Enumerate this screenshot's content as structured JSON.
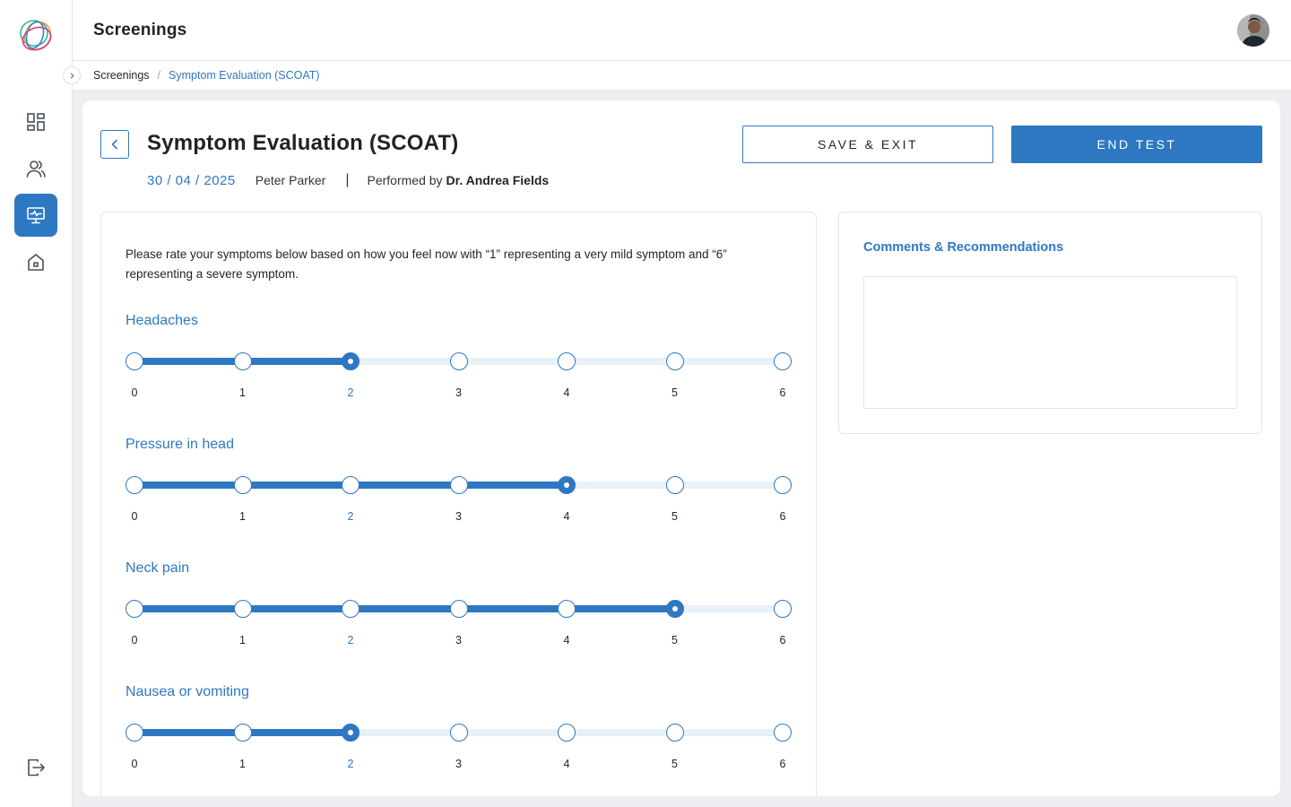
{
  "header": {
    "title": "Screenings"
  },
  "breadcrumb": {
    "items": [
      "Screenings"
    ],
    "separator": "/",
    "current": "Symptom Evaluation (SCOAT)"
  },
  "sidebar": {
    "items": [
      {
        "name": "dashboard",
        "icon": "dashboard-grid-icon",
        "active": false
      },
      {
        "name": "users",
        "icon": "users-icon",
        "active": false
      },
      {
        "name": "screenings",
        "icon": "monitor-screening-icon",
        "active": true
      },
      {
        "name": "home",
        "icon": "home-icon",
        "active": false
      }
    ],
    "logout_icon": "logout-icon"
  },
  "test": {
    "title": "Symptom Evaluation (SCOAT)",
    "date": "30 / 04 / 2025",
    "patient": "Peter Parker",
    "separator": "|",
    "performed_by_label": "Performed by",
    "doctor": "Dr. Andrea Fields",
    "save_exit_label": "SAVE & EXIT",
    "end_test_label": "END TEST"
  },
  "instructions": "Please rate your symptoms below based on how you feel now with “1” representing a very mild symptom and “6” representing a severe symptom.",
  "scale": {
    "min": 0,
    "max": 6,
    "ticks": [
      "0",
      "1",
      "2",
      "3",
      "4",
      "5",
      "6"
    ],
    "highlight_tick": 2
  },
  "symptoms": [
    {
      "label": "Headaches",
      "value": 2
    },
    {
      "label": "Pressure in head",
      "value": 4
    },
    {
      "label": "Neck pain",
      "value": 5
    },
    {
      "label": "Nausea or vomiting",
      "value": 2
    }
  ],
  "comments": {
    "heading": "Comments & Recommendations",
    "value": ""
  },
  "colors": {
    "accent": "#2e78c2",
    "track": "#e8f0f8",
    "canvas": "#eceef1"
  }
}
